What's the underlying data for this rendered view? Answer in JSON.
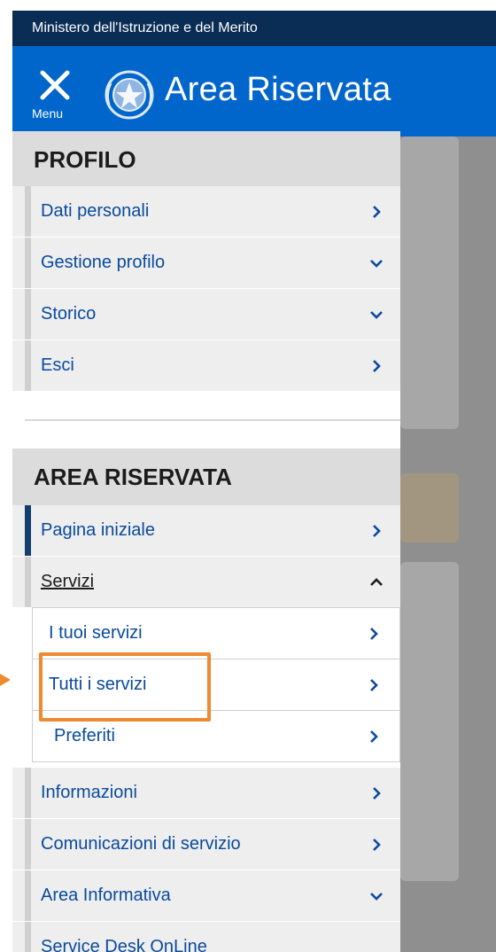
{
  "topbar": {
    "ministry": "Ministero dell'Istruzione e del Merito"
  },
  "header": {
    "title": "Area Riservata",
    "menu_label": "Menu",
    "close_icon": "close-icon",
    "emblem_icon": "italian-emblem-icon"
  },
  "profilo": {
    "title": "PROFILO",
    "items": [
      {
        "label": "Dati personali",
        "chevron": "right"
      },
      {
        "label": "Gestione profilo",
        "chevron": "down"
      },
      {
        "label": "Storico",
        "chevron": "down"
      },
      {
        "label": "Esci",
        "chevron": "right"
      }
    ]
  },
  "area": {
    "title": "AREA RISERVATA",
    "items": [
      {
        "label": "Pagina iniziale",
        "chevron": "right"
      },
      {
        "label": "Servizi",
        "chevron": "up"
      },
      {
        "label": "Informazioni",
        "chevron": "right"
      },
      {
        "label": "Comunicazioni di servizio",
        "chevron": "right"
      },
      {
        "label": "Area Informativa",
        "chevron": "down"
      },
      {
        "label": "Service Desk OnLine",
        "chevron": "right"
      }
    ],
    "servizi_sub": [
      {
        "label": "I tuoi servizi"
      },
      {
        "label": "Tutti i servizi"
      },
      {
        "label": "Preferiti"
      }
    ]
  },
  "colors": {
    "header": "#0066cc",
    "topbar": "#0a2d55",
    "link": "#0a4a9c",
    "highlight": "#f08a30"
  }
}
